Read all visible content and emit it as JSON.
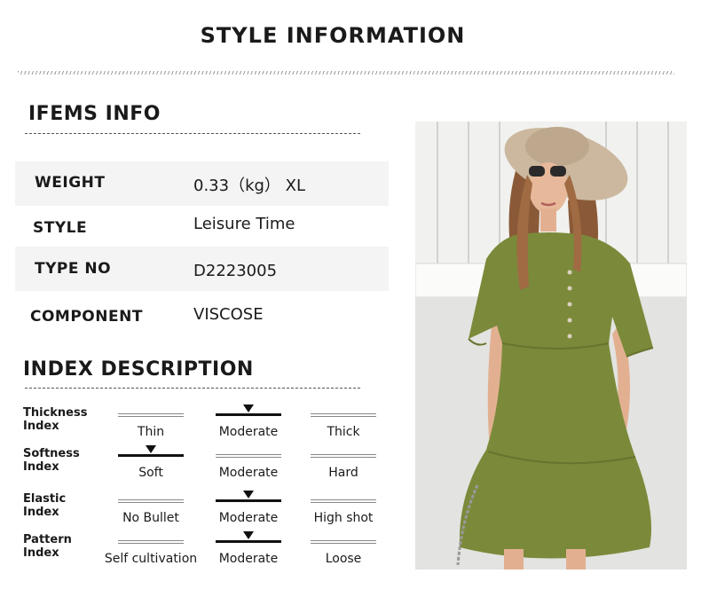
{
  "page": {
    "title": "STYLE INFORMATION"
  },
  "items_info": {
    "title": "IFEMS INFO",
    "rows": [
      {
        "label": "WEIGHT",
        "value": "0.33（kg） XL"
      },
      {
        "label": "STYLE",
        "value": "Leisure Time"
      },
      {
        "label": "TYPE NO",
        "value": "D2223005"
      },
      {
        "label": "COMPONENT",
        "value": "VISCOSE"
      }
    ]
  },
  "index_description": {
    "title": "INDEX DESCRIPTION",
    "rows": [
      {
        "label_line1": "Thickness",
        "label_line2": "Index",
        "options": [
          "Thin",
          "Moderate",
          "Thick"
        ],
        "selected": 1
      },
      {
        "label_line1": "Softness",
        "label_line2": "Index",
        "options": [
          "Soft",
          "Moderate",
          "Hard"
        ],
        "selected": 0
      },
      {
        "label_line1": "Elastic",
        "label_line2": "Index",
        "options": [
          "No Bullet",
          "Moderate",
          "High shot"
        ],
        "selected": 1
      },
      {
        "label_line1": "Pattern",
        "label_line2": "Index",
        "options": [
          "Self cultivation",
          "Moderate",
          "Loose"
        ],
        "selected": 1
      }
    ]
  },
  "colors": {
    "dress": "#7a8a3a",
    "hat": "#cbb89f",
    "wall": "#e9e9e9"
  }
}
